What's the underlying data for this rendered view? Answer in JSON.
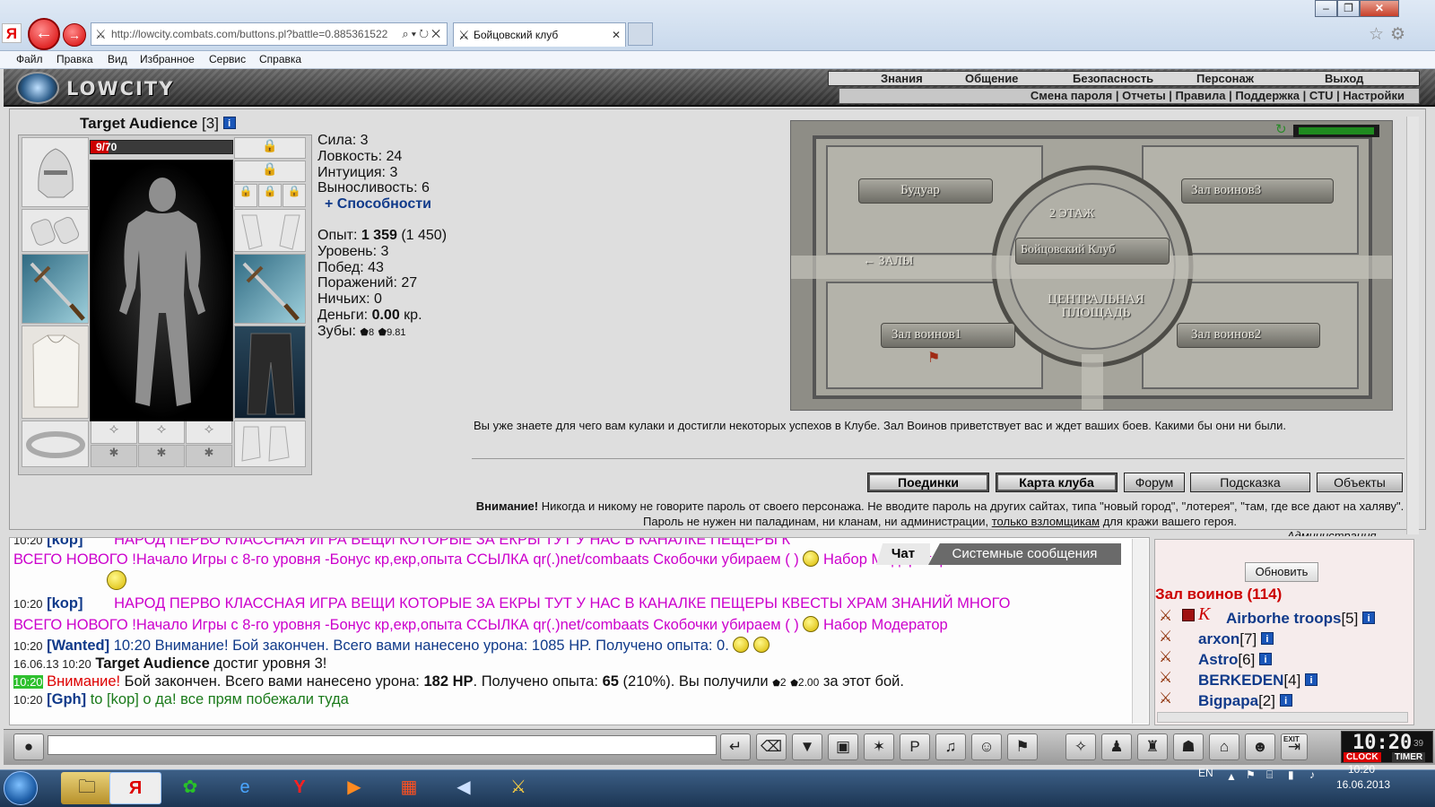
{
  "browser": {
    "url": "http://lowcity.combats.com/buttons.pl?battle=0.885361522",
    "tab_title": "Бойцовский клуб",
    "ya_logo": "Я",
    "menu": [
      "Файл",
      "Правка",
      "Вид",
      "Избранное",
      "Сервис",
      "Справка"
    ]
  },
  "game": {
    "logo": "LOWCITY",
    "topnav": [
      "Знания",
      "Общение",
      "Безопасность",
      "Персонаж",
      "Выход"
    ],
    "subnav": "Смена пароля | Отчеты | Правила | Поддержка | CTU | Настройки"
  },
  "character": {
    "name": "Target Audience",
    "level": "[3]",
    "hp_text": "9/70",
    "hp_fraction": 0.129,
    "stats": {
      "strength": "Сила: 3",
      "agility": "Ловкость: 24",
      "intuition": "Интуиция: 3",
      "endurance": "Выносливость: 6",
      "abilities": "+ Способности",
      "exp_label": "Опыт: ",
      "exp_value": "1 359",
      "exp_next": " (1 450)",
      "level": "Уровень: 3",
      "wins": "Побед: 43",
      "losses": "Поражений: 27",
      "draws": "Ничьих: 0",
      "money_label": "Деньги: ",
      "money_value": "0.00",
      "money_unit": " кр.",
      "teeth_label": "Зубы: ",
      "teeth_a": "8",
      "teeth_b": "9.81"
    }
  },
  "map": {
    "floor": "2 ЭТАЖ",
    "boudoir": "Будуар",
    "hall3": "Зал воинов3",
    "club": "Бойцовский Клуб",
    "halls": "← ЗАЛЫ",
    "square": "ЦЕНТРАЛЬНАЯ ПЛОЩАДЬ",
    "hall1": "Зал воинов1",
    "hall2": "Зал воинов2"
  },
  "welcome_text": "Вы уже знаете для чего вам кулаки и достигли некоторых успехов в Клубе. Зал Воинов приветствует вас и ждет ваших боев. Какими бы они ни были.",
  "buttons": {
    "duels": "Поединки",
    "club_map": "Карта клуба",
    "forum": "Форум",
    "hint": "Подсказка",
    "objects": "Объекты"
  },
  "warning": {
    "bold": "Внимание!",
    "text1": " Никогда и никому не говорите пароль от своего персонажа. Не вводите пароль на других сайтах, типа \"новый город\", \"лотерея\", \"там, где все дают на халяву\". Пароль не нужен ни паладинам, ни кланам, ни администрации, ",
    "link": "только взломщикам",
    "text2": " для кражи вашего героя.",
    "sign": "Администрация."
  },
  "chat": {
    "tabs": [
      "Чат",
      "Системные сообщения"
    ],
    "lines": {
      "l1_time": "10:20",
      "l1_nick": "[kop]",
      "l1_msg": "НАРОД ПЕРВО КЛАССНАЯ ИГРА ВЕЩИ КОТОРЫЕ ЗА ЕКРЫ ТУТ У НАС В КАНАЛКЕ ПЕЩЕРЫ К",
      "l2_msg": "ВСЕГО НОВОГО !Начало Игры с 8-го уровня -Бонус кр,екр,опыта ССЫЛКА qr(.)net/combaats Скобочки убираем ( )",
      "l2_tail": "Набор Модератор",
      "l3_time": "10:20",
      "l3_nick": "[kop]",
      "l3_msg": "НАРОД ПЕРВО КЛАССНАЯ ИГРА ВЕЩИ КОТОРЫЕ ЗА ЕКРЫ ТУТ У НАС В КАНАЛКЕ ПЕЩЕРЫ КВЕСТЫ ХРАМ ЗНАНИЙ МНОГО",
      "l4_msg": "ВСЕГО НОВОГО !Начало Игры с 8-го уровня -Бонус кр,екр,опыта ССЫЛКА qr(.)net/combaats Скобочки убираем ( )",
      "l4_tail": "Набор Модератор",
      "l5_time": "10:20",
      "l5_nick": "[Wanted]",
      "l5_msg": "10:20 Внимание! Бой закончен. Всего вами нанесено урона: 1085 HP. Получено опыта: 0.",
      "l6_time": "16.06.13 10:20",
      "l6_name": "Target Audience",
      "l6_msg": " достиг уровня 3!",
      "l7_time": "10:20",
      "l7_warn": "Внимание!",
      "l7_msg1": " Бой закончен. Всего вами нанесено урона: ",
      "l7_hp": "182 HP",
      "l7_msg2": ". Получено опыта: ",
      "l7_exp": "65",
      "l7_msg3": " (210%). Вы получили ",
      "l7_t1": "2",
      "l7_t2": "2.00",
      "l7_msg4": " за этот бой.",
      "l8_time": "10:20",
      "l8_nick": "[Gph]",
      "l8_msg": " to [kop] о да! все прям побежали туда"
    }
  },
  "online": {
    "refresh": "Обновить",
    "room": "Зал воинов (114)",
    "users": [
      {
        "name": "Airborhe troops",
        "level": "[5]"
      },
      {
        "name": "arxon",
        "level": "[7]"
      },
      {
        "name": "Astro",
        "level": "[6]"
      },
      {
        "name": "BERKEDEN",
        "level": "[4]"
      },
      {
        "name": "Bigpapa",
        "level": "[2]"
      }
    ]
  },
  "clock": {
    "time": "10:20",
    "sec": "39",
    "clock_label": "CLOCK",
    "timer_label": "TIMER",
    "exit_label": "EXIT"
  },
  "taskbar": {
    "lang": "EN",
    "time": "10:20",
    "date": "16.06.2013"
  },
  "colors": {
    "accent_red": "#cc0000",
    "link_blue": "#103a8a",
    "spam_pink": "#cc00cc",
    "green": "#1a7a1a"
  }
}
